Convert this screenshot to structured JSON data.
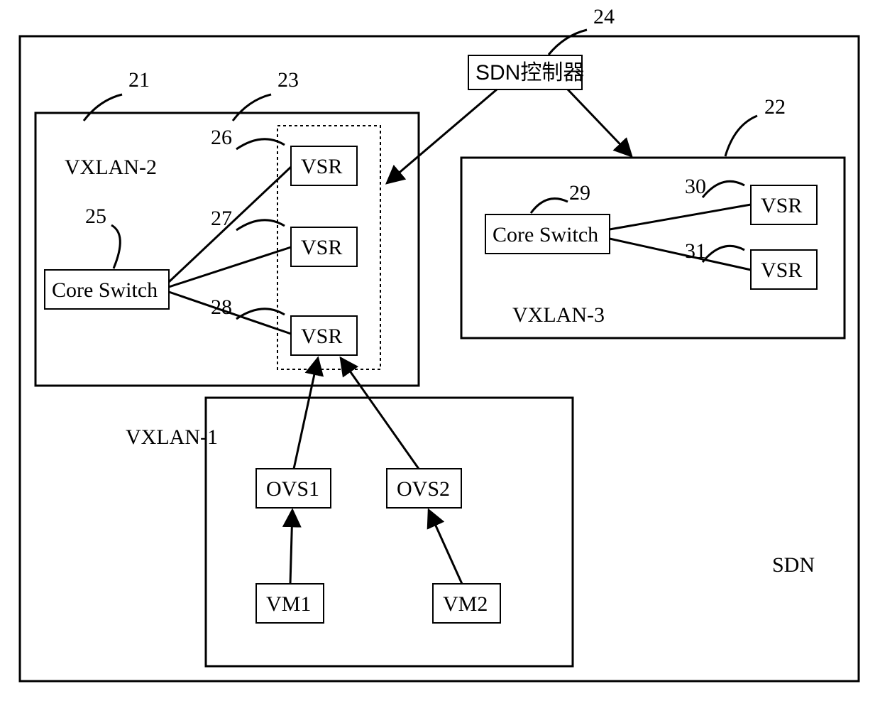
{
  "refs": {
    "r21": "21",
    "r22": "22",
    "r23": "23",
    "r24": "24",
    "r25": "25",
    "r26": "26",
    "r27": "27",
    "r28": "28",
    "r29": "29",
    "r30": "30",
    "r31": "31"
  },
  "labels": {
    "sdn": "SDN",
    "sdn_controller": "SDN控制器",
    "vxlan1": "VXLAN-1",
    "vxlan2": "VXLAN-2",
    "vxlan3": "VXLAN-3",
    "core_switch_a": "Core Switch",
    "core_switch_b": "Core Switch",
    "vsr26": "VSR",
    "vsr27": "VSR",
    "vsr28": "VSR",
    "vsr30": "VSR",
    "vsr31": "VSR",
    "ovs1": "OVS1",
    "ovs2": "OVS2",
    "vm1": "VM1",
    "vm2": "VM2"
  }
}
